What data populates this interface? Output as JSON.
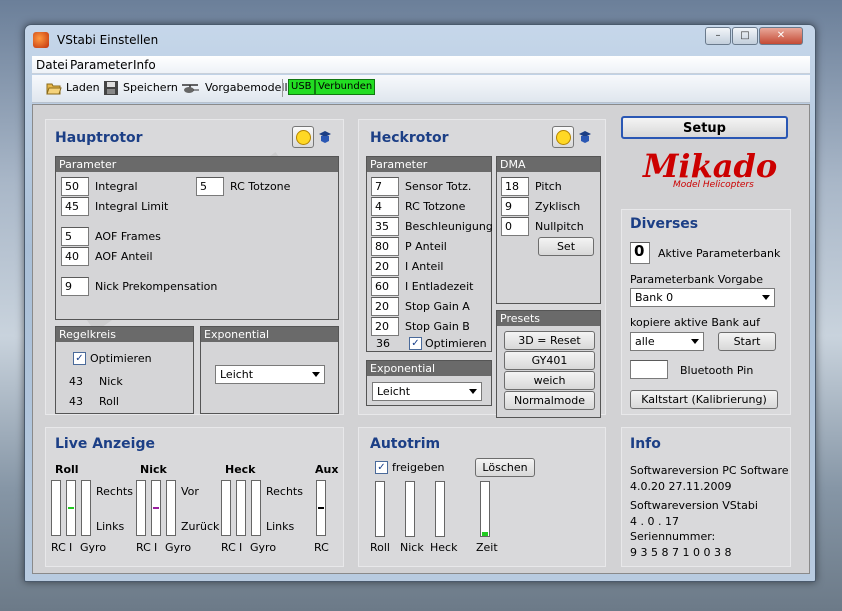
{
  "window": {
    "title": "VStabi Einstellen"
  },
  "menu": [
    "Datei",
    "Parameter",
    "Info"
  ],
  "toolbar": {
    "load": "Laden",
    "save": "Speichern",
    "default_model": "Vorgabemodell",
    "usb": "USB",
    "connected": "Verbunden"
  },
  "colors": {
    "accent_title": "#1c3f86",
    "status_green": "#22dd22",
    "group_header": "#6a6a6a"
  },
  "hauptrotor": {
    "title": "Hauptrotor",
    "params_title": "Parameter",
    "integral": {
      "value": "50",
      "label": "Integral"
    },
    "integral_limit": {
      "value": "45",
      "label": "Integral Limit"
    },
    "rc_totzone": {
      "value": "5",
      "label": "RC Totzone"
    },
    "aof_frames": {
      "value": "5",
      "label": "AOF Frames"
    },
    "aof_anteil": {
      "value": "40",
      "label": "AOF Anteil"
    },
    "nick_prek": {
      "value": "9",
      "label": "Nick Prekompensation"
    },
    "regelkreis": {
      "title": "Regelkreis",
      "optimize_label": "Optimieren",
      "nick_value": "43",
      "nick_label": "Nick",
      "roll_value": "43",
      "roll_label": "Roll"
    },
    "exponential": {
      "title": "Exponential",
      "value": "Leicht"
    }
  },
  "heckrotor": {
    "title": "Heckrotor",
    "params_title": "Parameter",
    "params": [
      {
        "value": "7",
        "label": "Sensor Totz."
      },
      {
        "value": "4",
        "label": "RC Totzone"
      },
      {
        "value": "35",
        "label": "Beschleunigung"
      },
      {
        "value": "80",
        "label": "P Anteil"
      },
      {
        "value": "20",
        "label": "I Anteil"
      },
      {
        "value": "60",
        "label": "I Entladezeit"
      },
      {
        "value": "20",
        "label": "Stop Gain A"
      },
      {
        "value": "20",
        "label": "Stop Gain B"
      }
    ],
    "opt_value": "36",
    "opt_label": "Optimieren",
    "dma": {
      "title": "DMA",
      "pitch_value": "18",
      "pitch_label": "Pitch",
      "zyklisch_value": "9",
      "zyklisch_label": "Zyklisch",
      "nullpitch_value": "0",
      "nullpitch_label": "Nullpitch",
      "set_label": "Set"
    },
    "presets": {
      "title": "Presets",
      "items": [
        "3D = Reset",
        "GY401",
        "weich",
        "Normalmode"
      ]
    },
    "exponential": {
      "title": "Exponential",
      "value": "Leicht"
    }
  },
  "setup": {
    "label": "Setup"
  },
  "logo": {
    "name": "Mikado",
    "sub": "Model Helicopters"
  },
  "diverses": {
    "title": "Diverses",
    "active_bank_value": "0",
    "active_bank_label": "Aktive Parameterbank",
    "vorgabe_label": "Parameterbank Vorgabe",
    "vorgabe_value": "Bank 0",
    "copy_label": "kopiere aktive Bank auf",
    "copy_value": "alle",
    "start_label": "Start",
    "bt_label": "Bluetooth Pin",
    "kaltstart_label": "Kaltstart (Kalibrierung)"
  },
  "live": {
    "title": "Live Anzeige",
    "roll": "Roll",
    "nick": "Nick",
    "heck": "Heck",
    "aux": "Aux",
    "rechts": "Rechts",
    "links": "Links",
    "vor": "Vor",
    "zurueck": "Zurück",
    "rc": "RC",
    "i": "I",
    "gyro": "Gyro"
  },
  "autotrim": {
    "title": "Autotrim",
    "freigeben": "freigeben",
    "loeschen": "Löschen",
    "labels": [
      "Roll",
      "Nick",
      "Heck",
      "Zeit"
    ]
  },
  "info": {
    "title": "Info",
    "pc_label": "Softwareversion PC Software",
    "pc_value": "4.0.20  27.11.2009",
    "vstabi_label": "Softwareversion VStabi",
    "vstabi_value": "4 . 0 . 17",
    "serial_label": "Seriennummer:",
    "serial_value": "9 3 5 8 7 1 0 0 3 8"
  }
}
